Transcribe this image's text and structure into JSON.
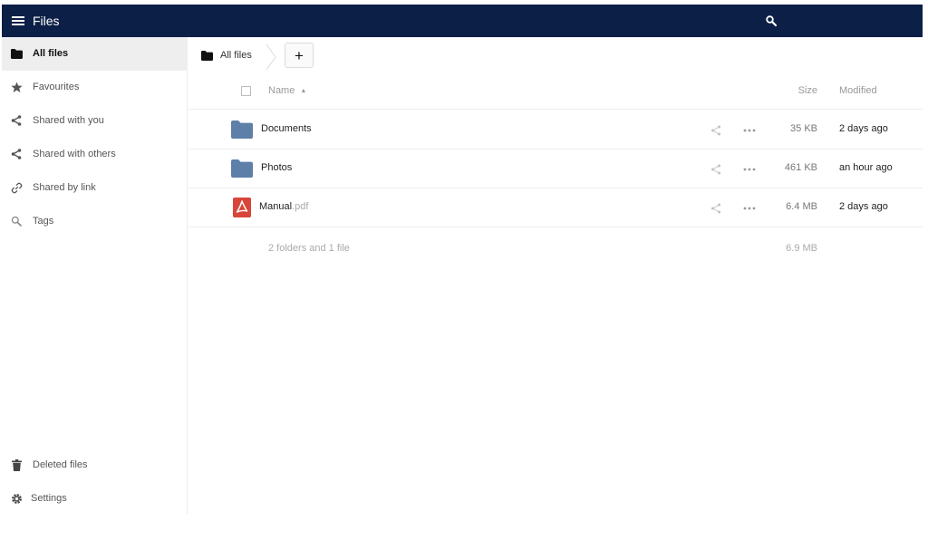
{
  "header": {
    "title": "Files",
    "menu_icon": "hamburger-icon",
    "search_icon": "search-icon",
    "background": "#0c1f46"
  },
  "sidebar": {
    "items": [
      {
        "label": "All files",
        "icon": "folder-icon",
        "active": true
      },
      {
        "label": "Favourites",
        "icon": "star-icon"
      },
      {
        "label": "Shared with you",
        "icon": "share-icon"
      },
      {
        "label": "Shared with others",
        "icon": "share-icon"
      },
      {
        "label": "Shared by link",
        "icon": "link-icon"
      },
      {
        "label": "Tags",
        "icon": "tag-search-icon"
      }
    ],
    "bottom_items": [
      {
        "label": "Deleted files",
        "icon": "trash-icon"
      },
      {
        "label": "Settings",
        "icon": "gear-icon"
      }
    ]
  },
  "breadcrumb": {
    "home_label": "All files",
    "new_button": "+"
  },
  "table": {
    "columns": {
      "name": "Name",
      "size": "Size",
      "modified": "Modified"
    },
    "rows": [
      {
        "name": "Documents",
        "ext": "",
        "type": "folder",
        "size": "35 KB",
        "modified": "2 days ago"
      },
      {
        "name": "Photos",
        "ext": "",
        "type": "folder",
        "size": "461 KB",
        "modified": "an hour ago"
      },
      {
        "name": "Manual",
        "ext": ".pdf",
        "type": "pdf",
        "size": "6.4 MB",
        "modified": "2 days ago"
      }
    ],
    "summary": {
      "text": "2 folders and 1 file",
      "size": "6.9 MB"
    }
  },
  "colors": {
    "folder": "#5e7fa8",
    "pdf": "#d8453a",
    "active_nav_bg": "#eeeeee"
  }
}
